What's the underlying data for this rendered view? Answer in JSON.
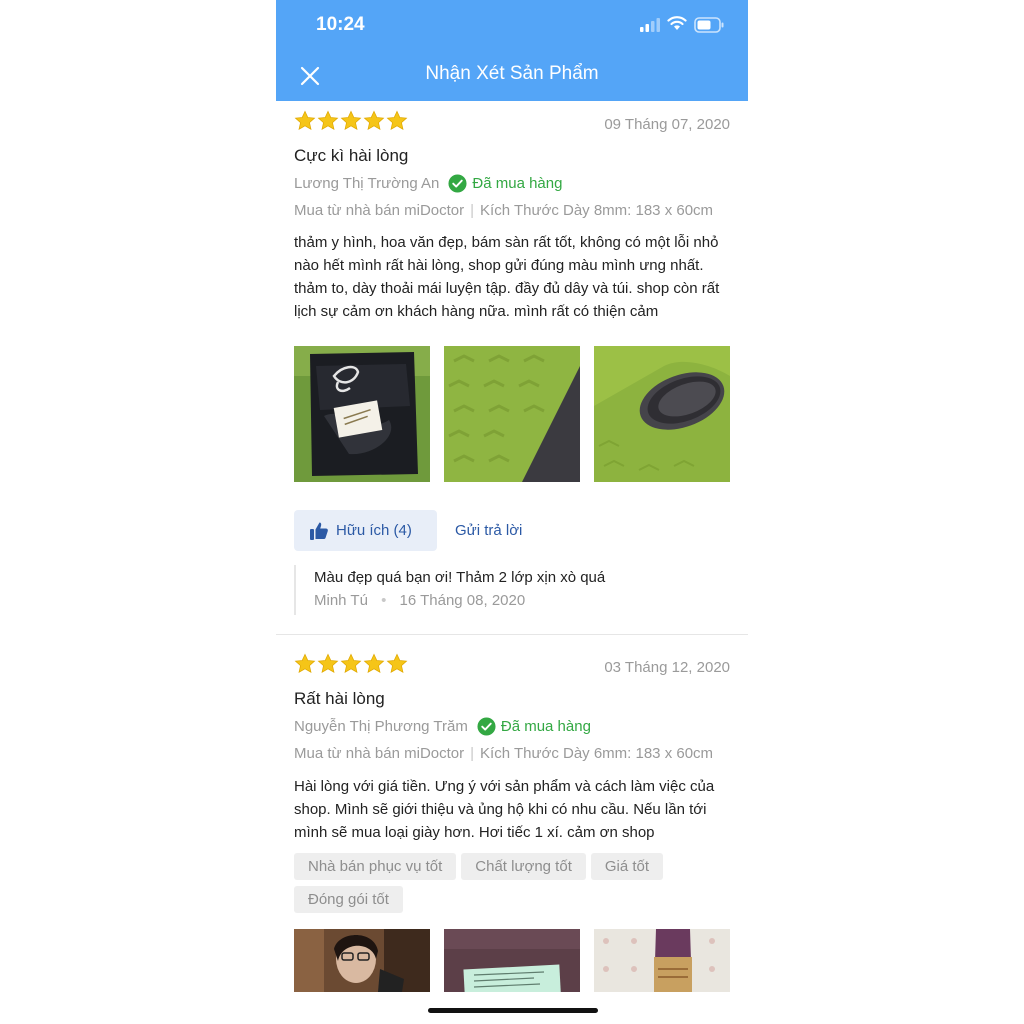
{
  "status_bar": {
    "time": "10:24"
  },
  "header": {
    "title": "Nhận Xét Sản Phẩm",
    "close_icon": "close-icon"
  },
  "colors": {
    "header_bg": "#54a5f7",
    "star": "#f5c518",
    "verified": "#33a843",
    "link": "#2b59a5"
  },
  "reviews": [
    {
      "rating": 5,
      "date": "09 Tháng 07, 2020",
      "title": "Cực kì hài lòng",
      "author": "Lương Thị Trường An",
      "verified_label": "Đã mua hàng",
      "seller": "Mua từ nhà bán miDoctor",
      "variant": "Kích Thước Dày 8mm: 183 x 60cm",
      "text": "thảm y hình, hoa văn đẹp, bám sàn rất tốt, không có một lỗi nhỏ nào hết mình rất hài lòng, shop gửi đúng màu mình ưng nhất. thảm to, dày thoải mái luyện tập. đầy đủ dây và túi. shop còn rất lịch sự cảm ơn khách hàng nữa. mình rất có thiện cảm",
      "photos": [
        "yoga-bag-photo",
        "green-mat-photo",
        "rolled-mat-photo"
      ],
      "helpful_label": "Hữu ích (4)",
      "reply_label": "Gửi trả lời",
      "reply": {
        "text": "Màu đẹp quá bạn ơi! Thảm 2 lớp xịn xò quá",
        "author": "Minh Tú",
        "dot": "•",
        "date": "16 Tháng 08, 2020"
      }
    },
    {
      "rating": 5,
      "date": "03 Tháng 12, 2020",
      "title": "Rất hài lòng",
      "author": "Nguyễn Thị Phương Trăm",
      "verified_label": "Đã mua hàng",
      "seller": "Mua từ nhà bán miDoctor",
      "variant": "Kích Thước Dày 6mm: 183 x 60cm",
      "text": "Hài lòng với giá tiền. Ưng ý với sản phẩm và cách làm việc của shop. Mình sẽ giới thiệu và ủng hộ khi có nhu cầu. Nếu lần tới mình sẽ mua loại giày hơn. Hơi tiếc 1 xí. cảm ơn shop",
      "tags": [
        "Nhà bán phục vụ tốt",
        "Chất lượng tốt",
        "Giá tốt",
        "Đóng gói tốt"
      ],
      "photos": [
        "person-photo",
        "purple-mat-photo",
        "mat-box-photo"
      ]
    }
  ]
}
